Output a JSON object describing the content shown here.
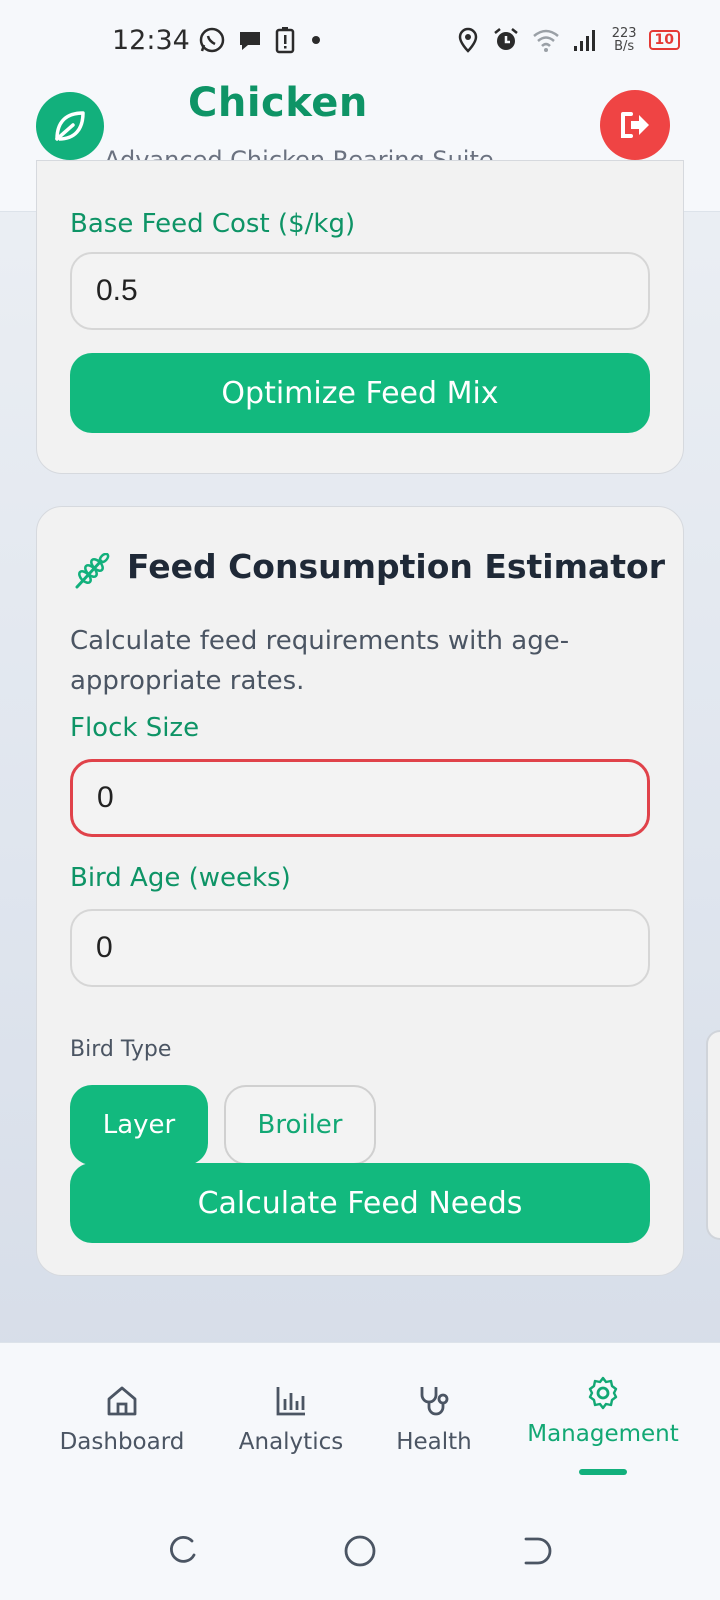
{
  "status_bar": {
    "time": "12:34",
    "net_speed_value": "223",
    "net_speed_unit": "B/s",
    "battery": "10"
  },
  "header": {
    "title": "Chicken",
    "subtitle": "Advanced Chicken Rearing Suite",
    "logo_icon": "leaf-icon",
    "logout_icon": "logout-icon"
  },
  "feed_mix_card": {
    "base_cost_label": "Base Feed Cost ($/kg)",
    "base_cost_value": "0.5",
    "optimize_button": "Optimize Feed Mix"
  },
  "estimator_card": {
    "title": "Feed Consumption Estimator",
    "title_icon": "wheat-icon",
    "description": "Calculate feed requirements with age-appropriate rates.",
    "flock_size_label": "Flock Size",
    "flock_size_value": "0",
    "bird_age_label": "Bird Age (weeks)",
    "bird_age_value": "0",
    "bird_type_label": "Bird Type",
    "bird_type_options": [
      "Layer",
      "Broiler"
    ],
    "bird_type_selected": "Layer",
    "calculate_button": "Calculate Feed Needs"
  },
  "bottom_nav": {
    "items": [
      {
        "label": "Dashboard",
        "icon": "home-icon"
      },
      {
        "label": "Analytics",
        "icon": "bar-chart-icon"
      },
      {
        "label": "Health",
        "icon": "stethoscope-icon"
      },
      {
        "label": "Management",
        "icon": "gear-icon"
      }
    ],
    "active": "Management"
  },
  "colors": {
    "brand_green": "#12b97e",
    "brand_green_dark": "#0e9466",
    "danger_red": "#ef4444"
  }
}
